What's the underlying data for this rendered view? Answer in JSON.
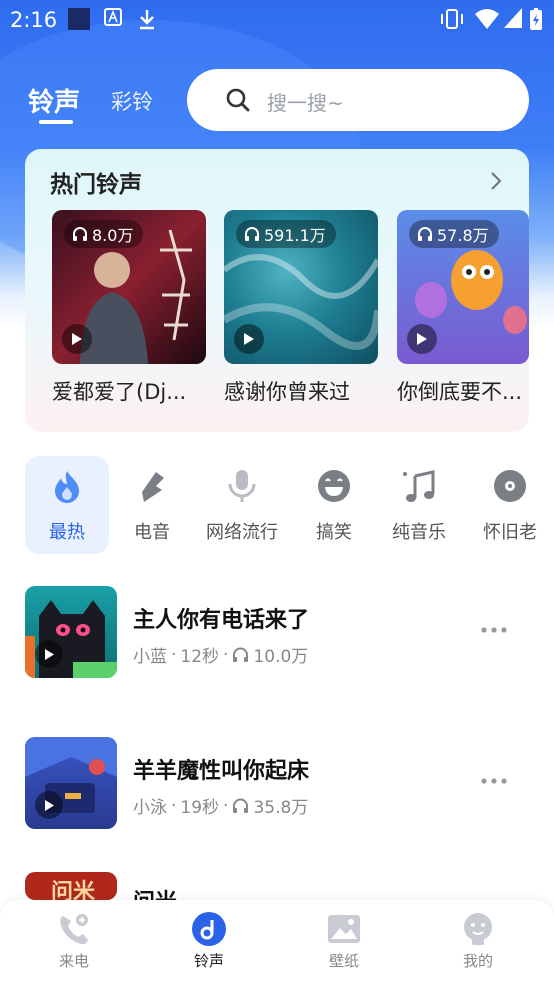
{
  "status_bar": {
    "time": "2:16"
  },
  "header": {
    "tabs": [
      {
        "label": "铃声",
        "active": true
      },
      {
        "label": "彩铃",
        "active": false
      }
    ],
    "search_placeholder": "搜一搜~"
  },
  "hot": {
    "title": "热门铃声",
    "items": [
      {
        "count": "8.0万",
        "name": "爱都爱了(Dj..."
      },
      {
        "count": "591.1万",
        "name": "感谢你曾来过"
      },
      {
        "count": "57.8万",
        "name": "你倒底要不..."
      }
    ]
  },
  "categories": [
    {
      "label": "最热",
      "icon": "flame-icon",
      "active": true
    },
    {
      "label": "电音",
      "icon": "lightning-icon",
      "active": false
    },
    {
      "label": "网络流行",
      "icon": "microphone-icon",
      "active": false
    },
    {
      "label": "搞笑",
      "icon": "laugh-face-icon",
      "active": false
    },
    {
      "label": "纯音乐",
      "icon": "music-note-icon",
      "active": false
    },
    {
      "label": "怀旧老",
      "icon": "disc-icon",
      "active": false
    }
  ],
  "songs": [
    {
      "title": "主人你有电话来了",
      "author": "小蓝",
      "duration": "12秒",
      "plays": "10.0万"
    },
    {
      "title": "羊羊魔性叫你起床",
      "author": "小泳",
      "duration": "19秒",
      "plays": "35.8万"
    },
    {
      "title": "问米",
      "cover_text": "问米"
    }
  ],
  "bottom_nav": [
    {
      "label": "来电",
      "icon": "phone-icon",
      "active": false
    },
    {
      "label": "铃声",
      "icon": "music-disc-icon",
      "active": true
    },
    {
      "label": "壁纸",
      "icon": "image-icon",
      "active": false
    },
    {
      "label": "我的",
      "icon": "profile-icon",
      "active": false
    }
  ],
  "colors": {
    "accent": "#2a63e8",
    "header_blue": "#2f6cf0"
  }
}
